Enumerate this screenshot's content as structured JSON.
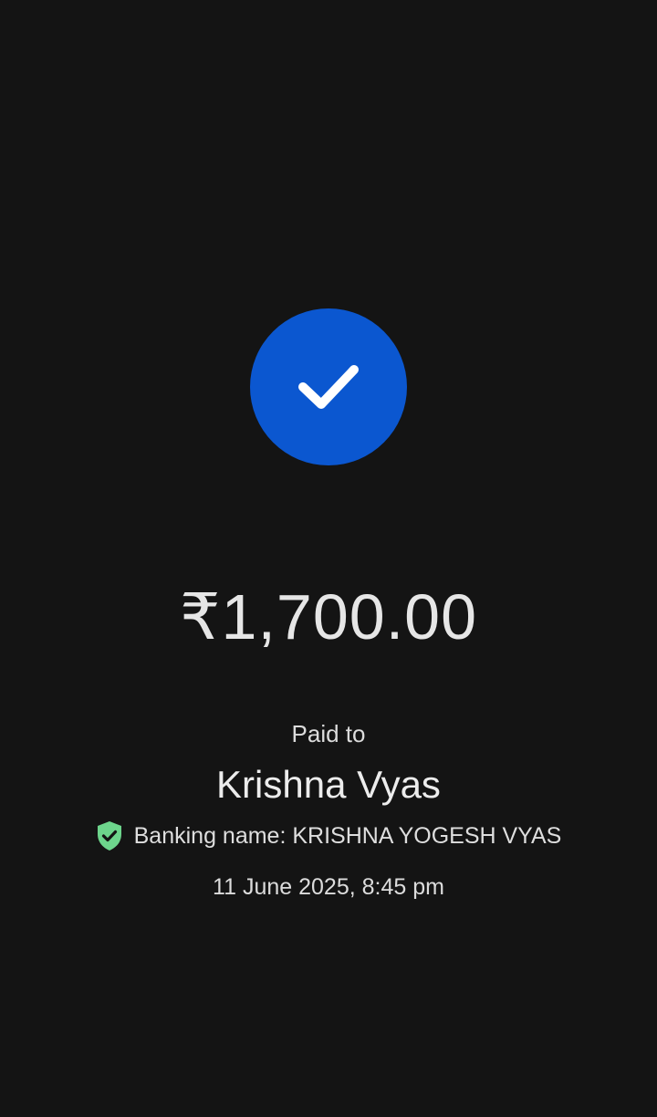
{
  "colors": {
    "background": "#141414",
    "accent": "#0b57d0",
    "verified": "#6dd58c",
    "text": "#e8e8e8"
  },
  "status": {
    "icon": "checkmark-icon"
  },
  "payment": {
    "amount": "₹1,700.00",
    "paid_to_label": "Paid to",
    "payee_name": "Krishna Vyas",
    "banking_name": "Banking name: KRISHNA YOGESH VYAS",
    "verified_icon": "verified-shield-icon",
    "timestamp": "11 June 2025, 8:45 pm"
  }
}
